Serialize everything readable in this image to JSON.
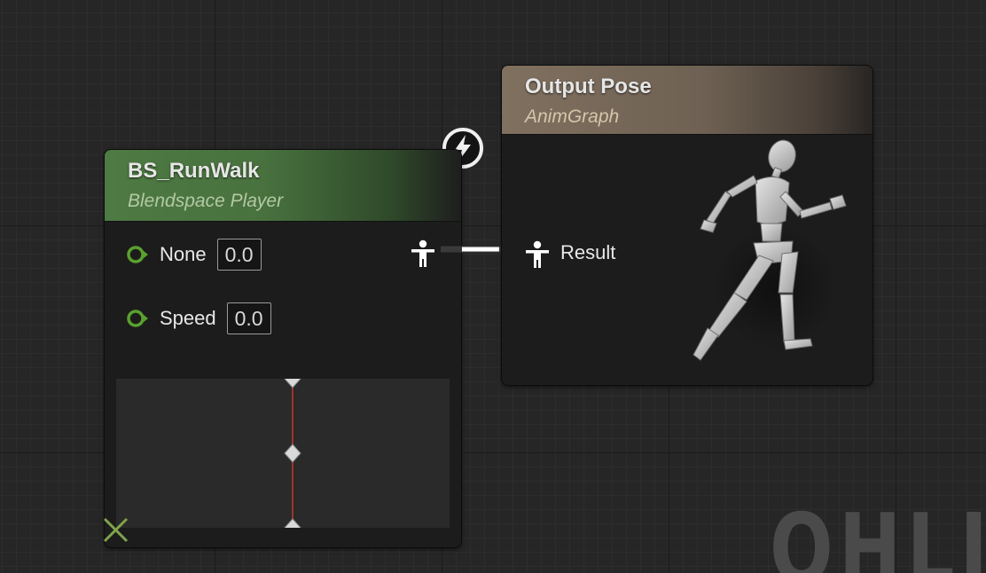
{
  "blendspace_node": {
    "title": "BS_RunWalk",
    "subtitle": "Blendspace Player",
    "inputs": [
      {
        "label": "None",
        "value": "0.0"
      },
      {
        "label": "Speed",
        "value": "0.0"
      }
    ],
    "header_color": "#4e7a43",
    "pin_color": "#5aa12e",
    "sample_point_count": 3
  },
  "output_node": {
    "title": "Output Pose",
    "subtitle": "AnimGraph",
    "input_label": "Result",
    "header_color": "#80705f"
  },
  "icons": {
    "exec": "lightning-bolt-icon",
    "pose_pin": "person-pose-icon",
    "remove": "close-x-icon",
    "preview": "mannequin-running-icon"
  },
  "watermark_text": "OHLJ",
  "colors": {
    "canvas_bg": "#262626",
    "grid_major": "#1b1b1b",
    "grid_minor": "#2d2d2d",
    "axis_line": "#c0392b",
    "x_icon": "#7fa34a"
  }
}
